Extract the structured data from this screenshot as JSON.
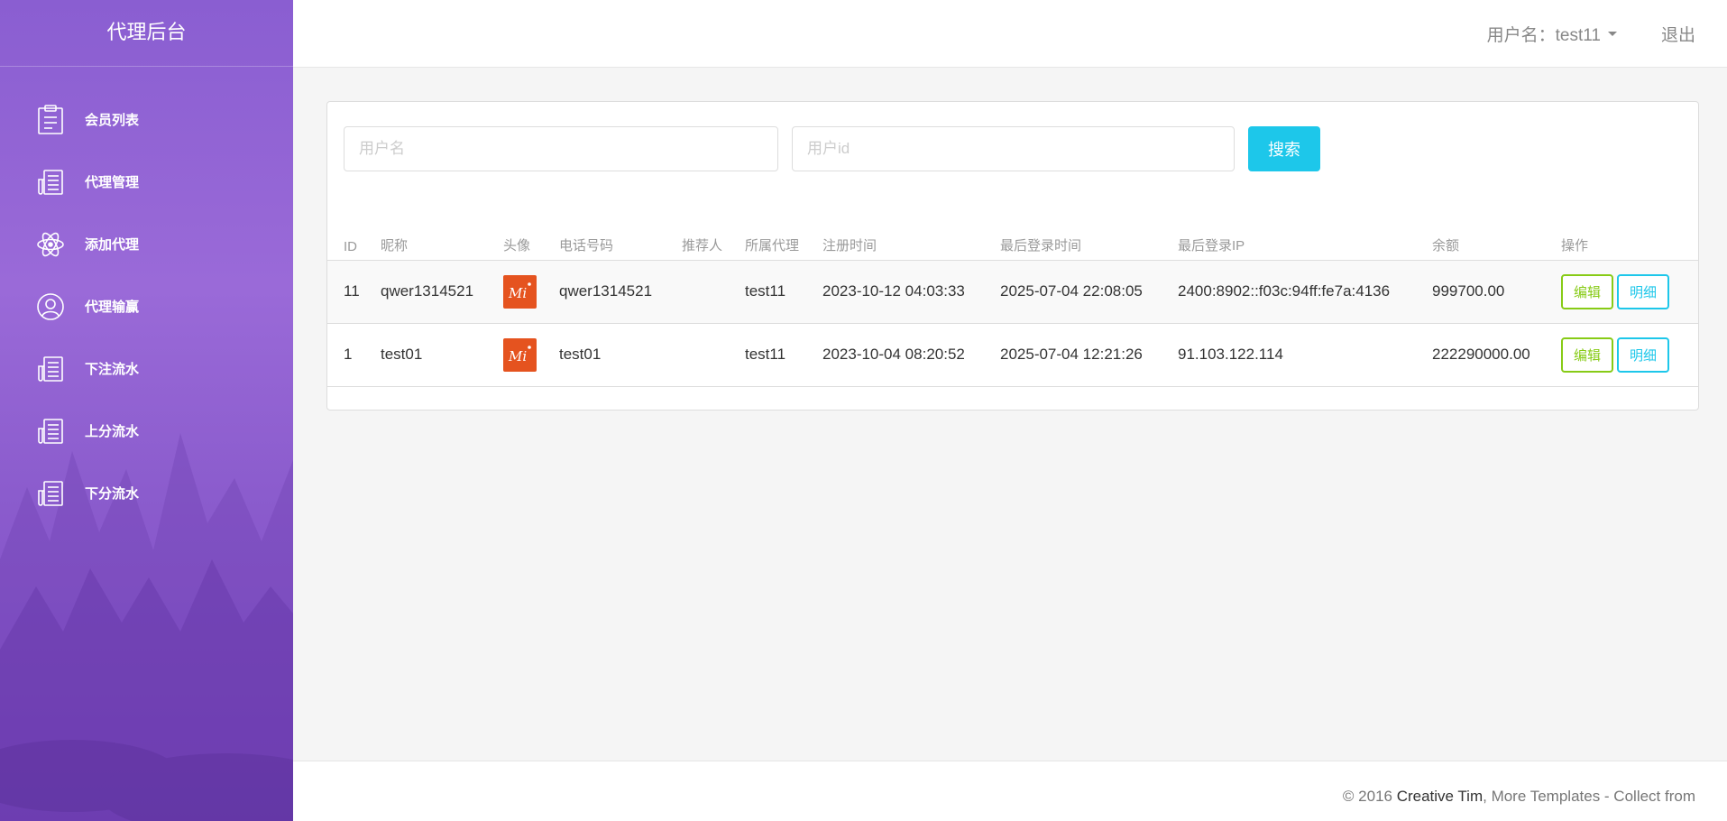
{
  "sidebar": {
    "brand": "代理后台",
    "items": [
      {
        "label": "会员列表",
        "icon": "clipboard-icon"
      },
      {
        "label": "代理管理",
        "icon": "news-icon"
      },
      {
        "label": "添加代理",
        "icon": "atom-icon"
      },
      {
        "label": "代理输赢",
        "icon": "user-circle-icon"
      },
      {
        "label": "下注流水",
        "icon": "news-icon"
      },
      {
        "label": "上分流水",
        "icon": "news-icon"
      },
      {
        "label": "下分流水",
        "icon": "news-icon"
      }
    ]
  },
  "header": {
    "user_label": "用户名：test11",
    "logout": "退出"
  },
  "search": {
    "username_placeholder": "用户名",
    "userid_placeholder": "用户id",
    "button": "搜索"
  },
  "table": {
    "columns": [
      "ID",
      "昵称",
      "头像",
      "电话号码",
      "推荐人",
      "所属代理",
      "注册时间",
      "最后登录时间",
      "最后登录IP",
      "余额",
      "操作"
    ],
    "rows": [
      {
        "id": "11",
        "nickname": "qwer1314521",
        "phone": "qwer1314521",
        "referrer": "",
        "agent": "test11",
        "registered": "2023-10-12 04:03:33",
        "last_login": "2025-07-04 22:08:05",
        "last_ip": "2400:8902::f03c:94ff:fe7a:4136",
        "balance": "999700.00"
      },
      {
        "id": "1",
        "nickname": "test01",
        "phone": "test01",
        "referrer": "",
        "agent": "test11",
        "registered": "2023-10-04 08:20:52",
        "last_login": "2025-07-04 12:21:26",
        "last_ip": "91.103.122.114",
        "balance": "222290000.00"
      }
    ],
    "edit_label": "编辑",
    "detail_label": "明细"
  },
  "footer": {
    "copyright": "© 2016 ",
    "author": "Creative Tim",
    "rest": ", More Templates - Collect from"
  },
  "colors": {
    "sidebar": "#8a5ed1",
    "primary": "#1dc7ea",
    "success": "#87cb16",
    "avatar": "#e5531f"
  }
}
